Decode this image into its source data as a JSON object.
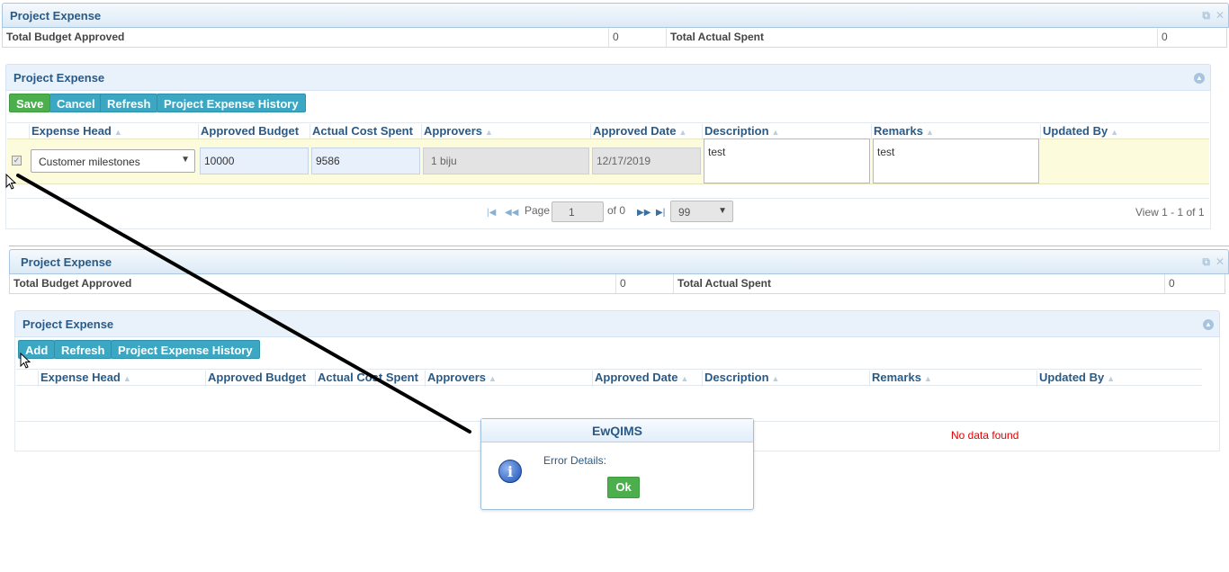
{
  "top": {
    "title": "Project Expense",
    "total_budget_label": "Total Budget Approved",
    "total_budget_value": "0",
    "total_spent_label": "Total Actual Spent",
    "total_spent_value": "0"
  },
  "edit_panel": {
    "title": "Project Expense",
    "buttons": {
      "save": "Save",
      "cancel": "Cancel",
      "refresh": "Refresh",
      "history": "Project Expense History"
    },
    "columns": [
      "Expense Head",
      "Approved Budget",
      "Actual Cost Spent",
      "Approvers",
      "Approved Date",
      "Description",
      "Remarks",
      "Updated By"
    ],
    "row": {
      "expense_head": "Customer milestones",
      "approved_budget": "10000",
      "actual_cost": "9586",
      "approvers": "1 biju",
      "approved_date": "12/17/2019",
      "description": "test",
      "remarks": "test",
      "updated_by": ""
    },
    "pager": {
      "page_label": "Page",
      "page_value": "1",
      "of_label": "of 0",
      "page_size": "99",
      "view_text": "View 1 - 1 of 1"
    }
  },
  "second": {
    "title": "Project Expense",
    "total_budget_label": "Total Budget Approved",
    "total_budget_value": "0",
    "total_spent_label": "Total Actual Spent",
    "total_spent_value": "0"
  },
  "list_panel": {
    "title": "Project Expense",
    "buttons": {
      "add": "Add",
      "refresh": "Refresh",
      "history": "Project Expense History"
    },
    "columns": [
      "Expense Head",
      "Approved Budget",
      "Actual Cost Spent",
      "Approvers",
      "Approved Date",
      "Description",
      "Remarks",
      "Updated By"
    ],
    "empty_text": "No data found"
  },
  "dialog": {
    "title": "EwQIMS",
    "message": "Error Details:",
    "ok_label": "Ok"
  },
  "colors": {
    "accent": "#2a5a86",
    "green": "#4cae4c",
    "teal": "#3ba7c2",
    "row_highlight": "#fcfcdc",
    "error_text": "#e00000"
  }
}
